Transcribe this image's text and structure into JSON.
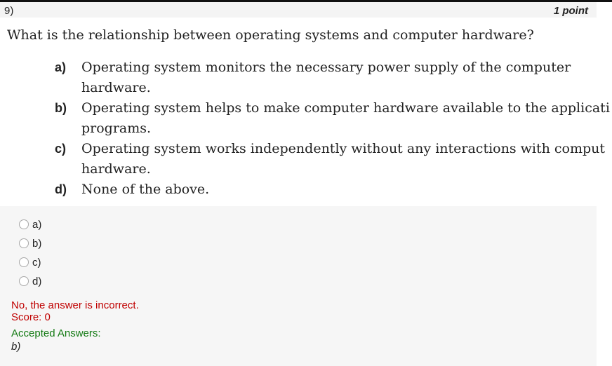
{
  "header": {
    "question_number": "9)",
    "points": "1 point"
  },
  "question": {
    "text": "What is the relationship between operating systems and computer hardware?"
  },
  "options": [
    {
      "letter": "a)",
      "line1": "Operating system monitors the necessary power supply of the computer",
      "line2": "hardware."
    },
    {
      "letter": "b)",
      "line1": "Operating system helps to make computer hardware available to the applicati",
      "line2": "programs."
    },
    {
      "letter": "c)",
      "line1": "Operating system works independently without any interactions with comput",
      "line2": "hardware."
    },
    {
      "letter": "d)",
      "line1": "None of the above.",
      "line2": ""
    }
  ],
  "radios": [
    {
      "label": "a)"
    },
    {
      "label": "b)"
    },
    {
      "label": "c)"
    },
    {
      "label": "d)"
    }
  ],
  "feedback": {
    "result": "No, the answer is incorrect.",
    "score": "Score: 0",
    "accepted_label": "Accepted Answers:",
    "accepted_value": "b)"
  },
  "colors": {
    "incorrect": "#c00000",
    "accepted": "#137a13"
  }
}
